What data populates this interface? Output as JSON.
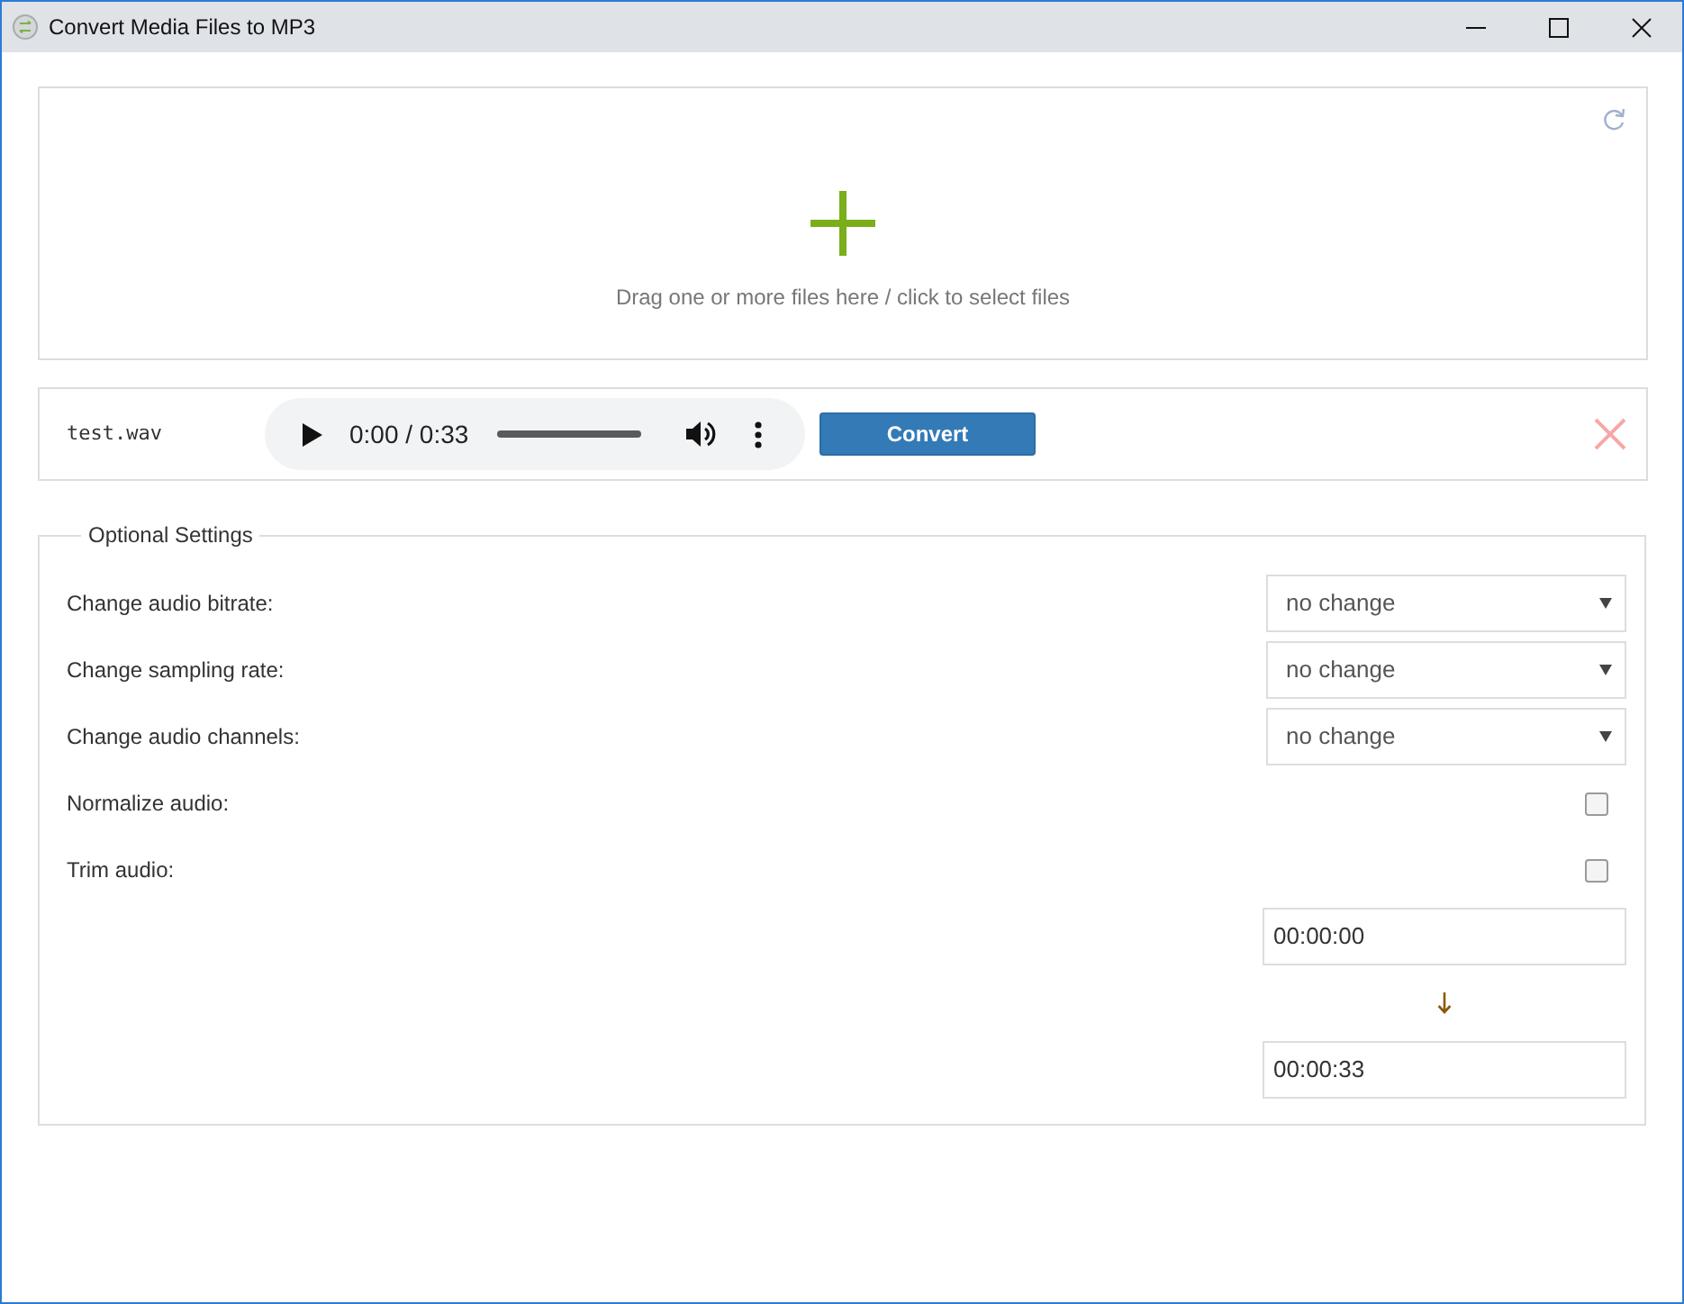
{
  "window": {
    "title": "Convert Media Files to MP3"
  },
  "drop_zone": {
    "text": "Drag one or more files here / click to select files"
  },
  "files": [
    {
      "name": "test.wav",
      "time": "0:00 / 0:33",
      "button": "Convert"
    }
  ],
  "settings": {
    "legend": "Optional Settings",
    "rows": [
      {
        "kind": "select",
        "label": "Change audio bitrate:",
        "value": "no change"
      },
      {
        "kind": "select",
        "label": "Change sampling rate:",
        "value": "no change"
      },
      {
        "kind": "select",
        "label": "Change audio channels:",
        "value": "no change"
      },
      {
        "kind": "checkbox",
        "label": "Normalize audio:",
        "checked": false
      },
      {
        "kind": "checkbox",
        "label": "Trim audio:",
        "checked": false
      }
    ],
    "trim": {
      "start": "00:00:00",
      "end": "00:00:33"
    }
  }
}
